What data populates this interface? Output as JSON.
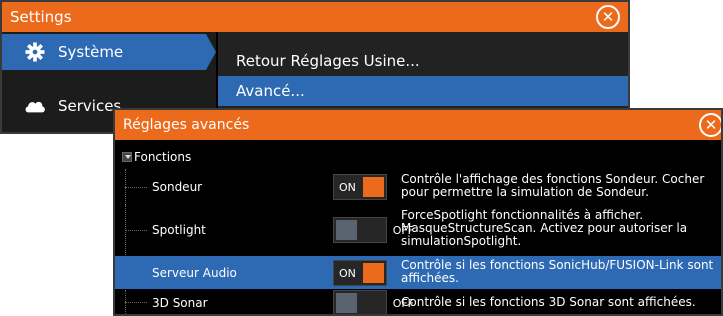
{
  "settings_window": {
    "title": "Settings",
    "sidebar": {
      "items": [
        {
          "label": "Système",
          "icon": "gear-icon",
          "active": true
        },
        {
          "label": "Services",
          "icon": "cloud-icon",
          "active": false
        },
        {
          "label": "",
          "icon": "document-icon",
          "active": false
        }
      ]
    },
    "menu": {
      "items": [
        {
          "label": "Retour Réglages Usine..."
        },
        {
          "label": "Avancé..."
        }
      ]
    }
  },
  "advanced_dialog": {
    "title": "Réglages avancés",
    "section": {
      "label": "Fonctions"
    },
    "rows": [
      {
        "name": "Sondeur",
        "state": "ON",
        "description": "Contrôle l'affichage des fonctions Sondeur. Cocher pour permettre la simulation de Sondeur."
      },
      {
        "name": "Spotlight",
        "state": "OFF",
        "description": "ForceSpotlight fonctionnalités à afficher. MasqueStructureScan. Activez pour autoriser la simulationSpotlight."
      },
      {
        "name": "Serveur Audio",
        "state": "ON",
        "description": "Contrôle si les fonctions SonicHub/FUSION-Link sont affichées."
      },
      {
        "name": "3D Sonar",
        "state": "OFF",
        "description": "Contrôle si les fonctions 3D Sonar sont affichées."
      }
    ]
  },
  "colors": {
    "accent_orange": "#ec6a1c",
    "selection_blue": "#2e69b4",
    "background": "#000000",
    "toggle_off_knob": "#5a6470"
  }
}
